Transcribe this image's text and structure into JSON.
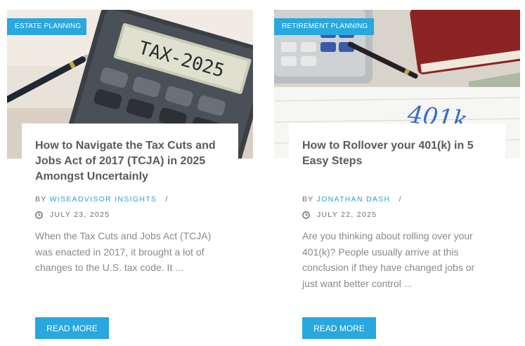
{
  "posts": [
    {
      "category": "ESTATE PLANNING",
      "calculator_display": "TAX-2025",
      "title": "How to Navigate the Tax Cuts and Jobs Act of 2017 (TCJA) in 2025 Amongst Uncertainly",
      "by_label": "BY",
      "author": "WISEADVISOR INSIGHTS",
      "separator": "/",
      "date": "JULY 23, 2025",
      "excerpt": "When the Tax Cuts and Jobs Act (TCJA) was enacted in 2017, it brought a lot of changes to the U.S. tax code. It ...",
      "button": "READ MORE"
    },
    {
      "category": "RETIREMENT PLANNING",
      "paper_text": "401k",
      "title": "How to Rollover your 401(k) in 5 Easy Steps",
      "by_label": "BY",
      "author": "JONATHAN DASH",
      "separator": "/",
      "date": "JULY 22, 2025",
      "excerpt": "Are you thinking about rolling over your 401(k)? People usually arrive at this conclusion if they have changed jobs or just want better control ...",
      "button": "READ MORE"
    }
  ],
  "colors": {
    "accent": "#29a7df",
    "title": "#5a5a5a",
    "text": "#8a8a8a"
  }
}
